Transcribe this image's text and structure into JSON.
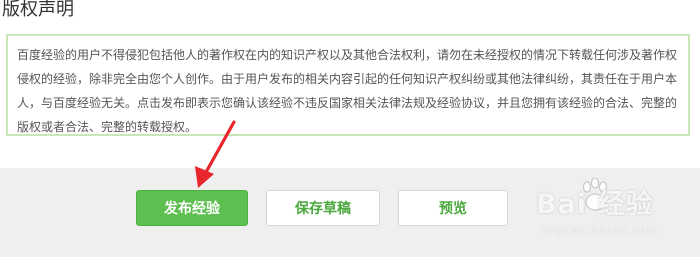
{
  "copyright": {
    "title": "版权声明",
    "notice": "百度经验的用户不得侵犯包括他人的著作权在内的知识产权以及其他合法权利，请勿在未经授权的情况下转载任何涉及著作权侵权的经验，除非完全由您个人创作。由于用户发布的相关内容引起的任何知识产权纠纷或其他法律纠纷，其责任在于用户本人，与百度经验无关。点击发布即表示您确认该经验不违反国家相关法律法规及经验协议，并且您拥有该经验的合法、完整的版权或者合法、完整的转载授权。"
  },
  "actions": {
    "publish_label": "发布经验",
    "save_draft_label": "保存草稿",
    "preview_label": "预览"
  },
  "watermark": {
    "logo_text": "Bai  经验",
    "url_text": "jingyan.baidu.com"
  },
  "colors": {
    "primary_green": "#5cbf4f",
    "text_green": "#4aa83d",
    "box_border": "#c9e6b8",
    "arrow_red": "#e8262b",
    "bar_background": "#efefef"
  }
}
